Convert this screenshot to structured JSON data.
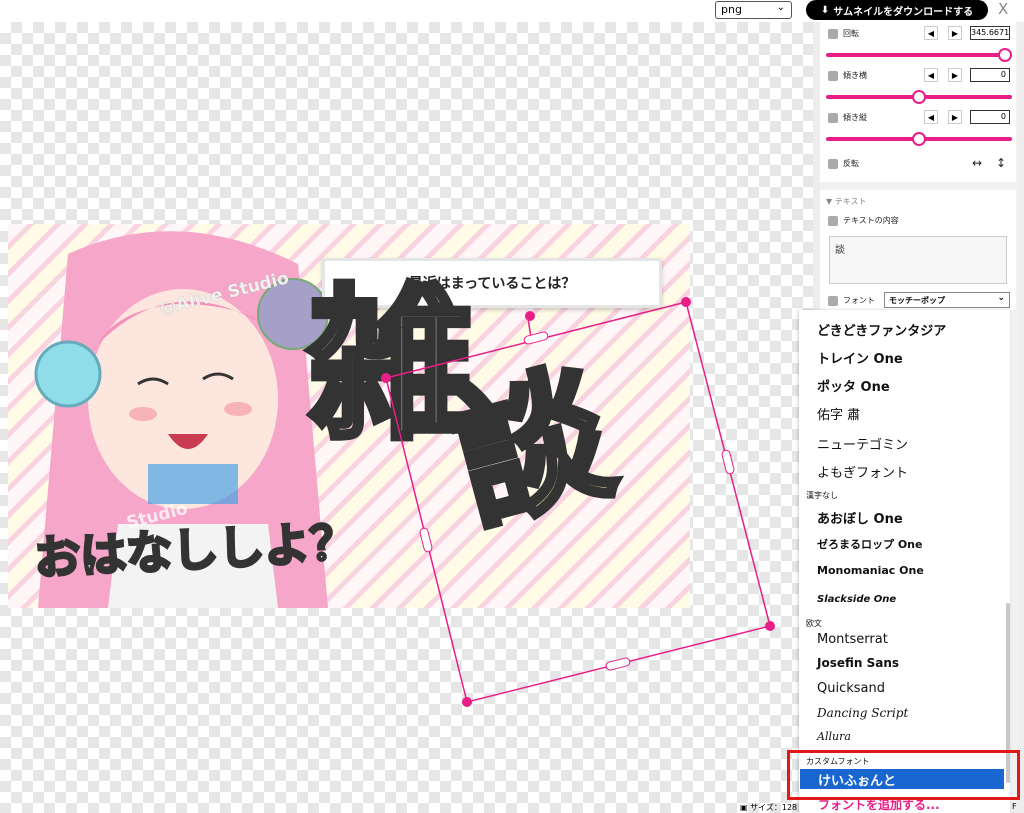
{
  "toolbar": {
    "format": "png",
    "download_label": "サムネイルをダウンロードする",
    "close": "X"
  },
  "thumbnail": {
    "topic": "最近はまっていることは？",
    "main_char1": "雑",
    "main_char2": "談",
    "subtitle": "おはなししよ？",
    "watermark": "@Alive Studio",
    "watermark2": "Studio"
  },
  "props": {
    "rotate_label": "回転",
    "rotate_value": "345.6671",
    "rotate_level": 0.96,
    "skewx_label": "傾き横",
    "skewx_value": "0",
    "skewx_level": 0.5,
    "skewy_label": "傾き縦",
    "skewy_value": "0",
    "skewy_level": 0.5,
    "flip_label": "反転",
    "flip_h": "↔",
    "flip_v": "↕"
  },
  "text_section": {
    "header": "▼ テキスト",
    "content_label": "テキストの内容",
    "content_value": "談",
    "font_label": "フォント",
    "font_value": "モッチーポップ"
  },
  "dropdown": {
    "items_top": [
      "どきどきファンタジア",
      "トレイン One",
      "ポッタ One",
      "佑字 肅",
      "ニューテゴミン",
      "よもぎフォント"
    ],
    "group_kanji": "漢字なし",
    "items_kanji": [
      "あおぼし One",
      "ゼろまるロップ One",
      "Monomaniac One",
      "Slackside One"
    ],
    "group_latin": "欧文",
    "items_latin": [
      "Montserrat",
      "Josefin Sans",
      "Quicksand",
      "Dancing Script",
      "Allura"
    ],
    "group_custom": "カスタムフォント",
    "selected": "けいふぉんと",
    "add_font": "フォントを追加する..."
  },
  "status": {
    "size": "サイズ：128",
    "end": "F"
  },
  "colors": {
    "accent": "#e91e87",
    "highlight": "#e01818",
    "selected": "#1a66d0"
  }
}
